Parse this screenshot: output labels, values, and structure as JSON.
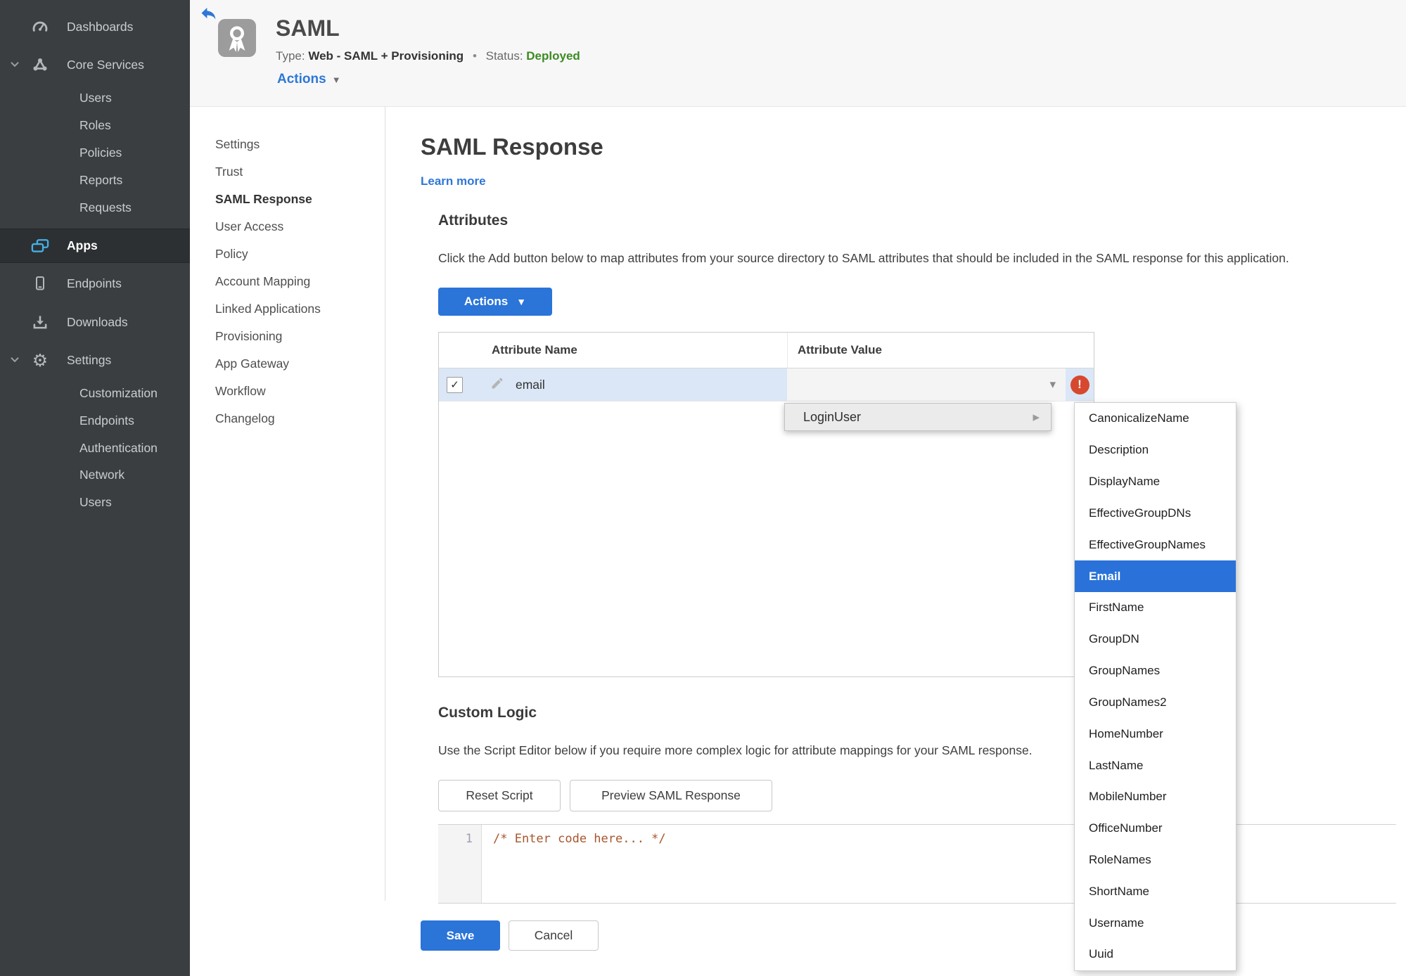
{
  "sidebar": {
    "items": [
      {
        "label": "Dashboards"
      },
      {
        "label": "Core Services"
      },
      {
        "label": "Users"
      },
      {
        "label": "Roles"
      },
      {
        "label": "Policies"
      },
      {
        "label": "Reports"
      },
      {
        "label": "Requests"
      },
      {
        "label": "Apps"
      },
      {
        "label": "Endpoints"
      },
      {
        "label": "Downloads"
      },
      {
        "label": "Settings"
      },
      {
        "label": "Customization"
      },
      {
        "label": "Endpoints"
      },
      {
        "label": "Authentication"
      },
      {
        "label": "Network"
      },
      {
        "label": "Users"
      }
    ],
    "active_item": "Apps"
  },
  "header": {
    "app_name": "SAML",
    "type_label": "Type:",
    "type_value": "Web - SAML + Provisioning",
    "separator": "•",
    "status_label": "Status:",
    "status_value": "Deployed",
    "actions_label": "Actions"
  },
  "subnav": {
    "items": [
      "Settings",
      "Trust",
      "SAML Response",
      "User Access",
      "Policy",
      "Account Mapping",
      "Linked Applications",
      "Provisioning",
      "App Gateway",
      "Workflow",
      "Changelog"
    ],
    "active_item": "SAML Response"
  },
  "main": {
    "title": "SAML Response",
    "learn_more": "Learn more",
    "attributes": {
      "heading": "Attributes",
      "description": "Click the Add button below to map attributes from your source directory to SAML attributes that should be included in the SAML response for this application.",
      "actions_button": "Actions",
      "table": {
        "columns": [
          "Attribute Name",
          "Attribute Value"
        ],
        "rows": [
          {
            "name": "email",
            "checked": "✓",
            "value": "",
            "has_error": true
          }
        ]
      }
    },
    "value_dropdown": {
      "label": "LoginUser",
      "selected_item": "Email",
      "submenu": [
        "CanonicalizeName",
        "Description",
        "DisplayName",
        "EffectiveGroupDNs",
        "EffectiveGroupNames",
        "Email",
        "FirstName",
        "GroupDN",
        "GroupNames",
        "GroupNames2",
        "HomeNumber",
        "LastName",
        "MobileNumber",
        "OfficeNumber",
        "RoleNames",
        "ShortName",
        "Username",
        "Uuid"
      ]
    },
    "custom_logic": {
      "heading": "Custom Logic",
      "description": "Use the Script Editor below if you require more complex logic for attribute mappings for your SAML response.",
      "reset_button": "Reset Script",
      "preview_button": "Preview SAML Response",
      "editor": {
        "line_number": "1",
        "code": "/* Enter code here... */"
      }
    },
    "save_button": "Save",
    "cancel_button": "Cancel"
  },
  "colors": {
    "accent_blue": "#2a72d9",
    "status_green": "#3c8b22",
    "error_red": "#d6492f",
    "apps_icon_cyan": "#45b0e6",
    "code_orange": "#a8552b",
    "sidebar_bg": "#3b3e41",
    "row_highlight": "#dbe7f6"
  }
}
